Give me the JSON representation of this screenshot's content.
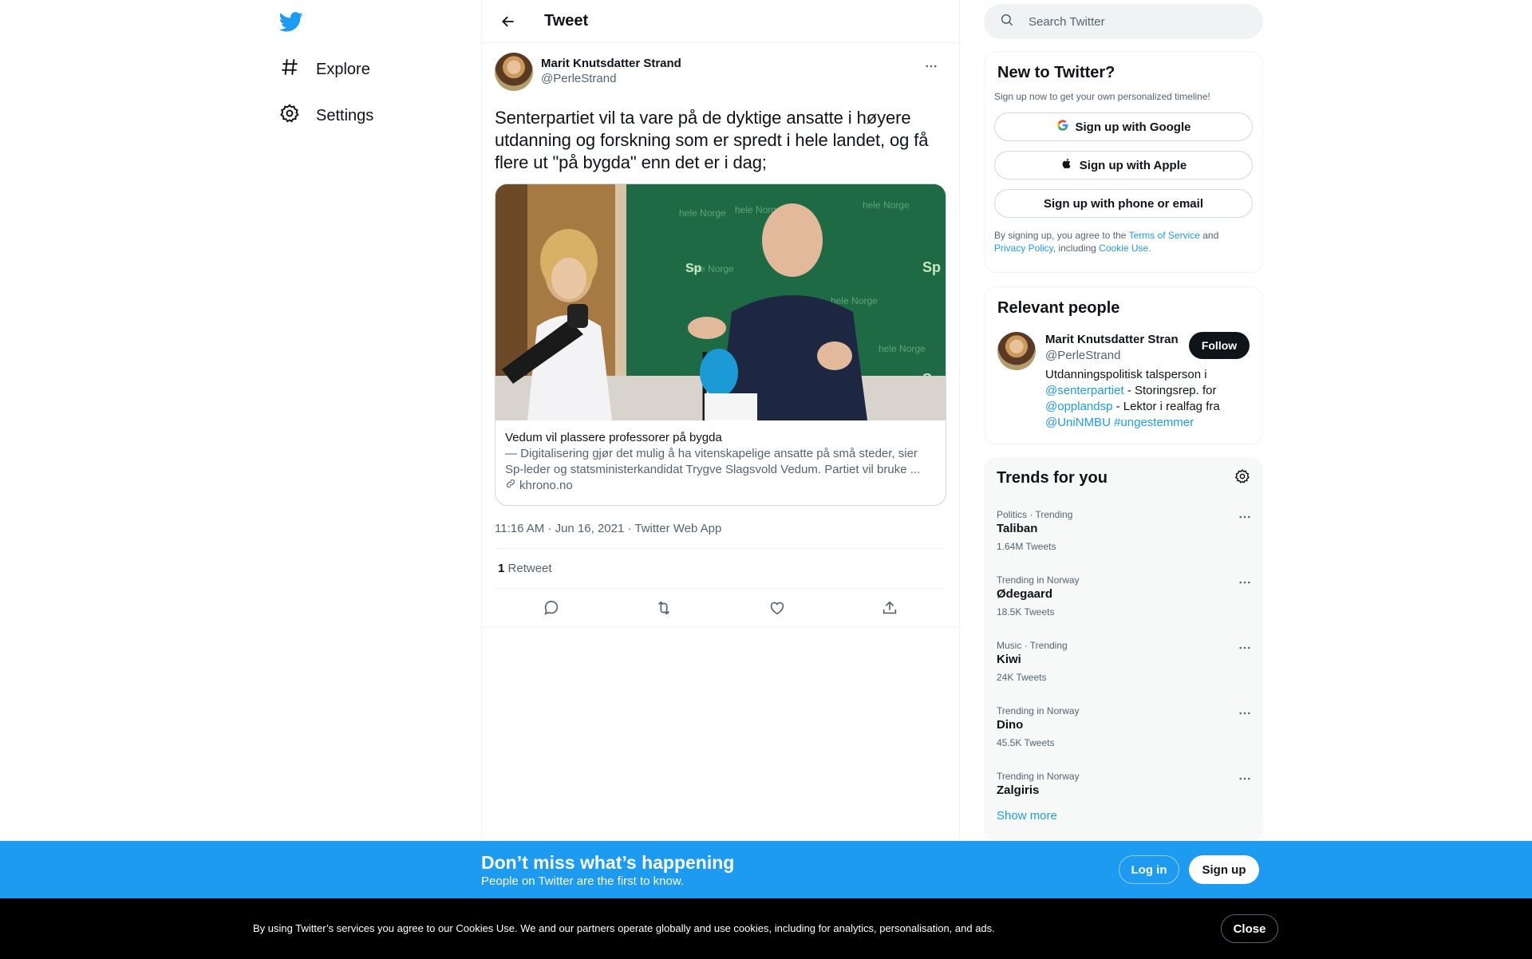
{
  "nav": {
    "logo": "twitter-bird",
    "items": [
      {
        "label": "Explore",
        "icon": "hashtag-icon"
      },
      {
        "label": "Settings",
        "icon": "gear-icon"
      }
    ]
  },
  "header": {
    "title": "Tweet"
  },
  "tweet": {
    "author_name": "Marit Knutsdatter Strand",
    "author_handle": "@PerleStrand",
    "text": "Senterpartiet vil ta vare på de dyktige ansatte i høyere utdanning og forskning som er spredt i hele landet, og få flere ut \"på bygda\" enn det er i dag;",
    "card": {
      "title": "Vedum vil plassere professorer på bygda",
      "description": "— Digitalisering gjør det mulig å ha vitenskapelige ansatte på små steder, sier Sp-leder og statsministerkandidat Trygve Slagsvold Vedum. Partiet vil bruke ...",
      "domain": "khrono.no"
    },
    "meta": "11:16 AM · Jun 16, 2021 · Twitter Web App",
    "retweet_count": "1",
    "retweet_label": "Retweet"
  },
  "search": {
    "placeholder": "Search Twitter"
  },
  "signup": {
    "title": "New to Twitter?",
    "subtitle": "Sign up now to get your own personalized timeline!",
    "google": "Sign up with Google",
    "apple": "Sign up with Apple",
    "phone": "Sign up with phone or email",
    "legal_prefix": "By signing up, you agree to the ",
    "terms": "Terms of Service",
    "and": " and",
    "privacy": "Privacy Policy",
    "including": ", including ",
    "cookie": "Cookie Use."
  },
  "relevant": {
    "title": "Relevant people",
    "name": "Marit Knutsdatter Strand",
    "handle": "@PerleStrand",
    "follow": "Follow",
    "bio_1": "Utdanningspolitisk talsperson i ",
    "mention_1": "@senterpartiet",
    "bio_2": " - Storingsrep. for ",
    "mention_2": "@opplandsp",
    "bio_3": " - Lektor i realfag fra ",
    "mention_3": "@UniNMBU",
    "hashtag": "#ungestemmer"
  },
  "trends": {
    "title": "Trends for you",
    "items": [
      {
        "category": "Politics · Trending",
        "title": "Taliban",
        "count": "1.64M Tweets"
      },
      {
        "category": "Trending in Norway",
        "title": "Ødegaard",
        "count": "18.5K Tweets"
      },
      {
        "category": "Music · Trending",
        "title": "Kiwi",
        "count": "24K Tweets"
      },
      {
        "category": "Trending in Norway",
        "title": "Dino",
        "count": "45.5K Tweets"
      },
      {
        "category": "Trending in Norway",
        "title": "Zalgiris",
        "count": ""
      }
    ],
    "show_more": "Show more"
  },
  "banner": {
    "headline": "Don’t miss what’s happening",
    "sub": "People on Twitter are the first to know.",
    "login": "Log in",
    "signup": "Sign up"
  },
  "cookies": {
    "text": "By using Twitter’s services you agree to our Cookies Use. We and our partners operate globally and use cookies, including for analytics, personalisation, and ads.",
    "close": "Close"
  },
  "colors": {
    "accent": "#1d9bf0",
    "text": "#0f1419",
    "secondary": "#536471"
  }
}
